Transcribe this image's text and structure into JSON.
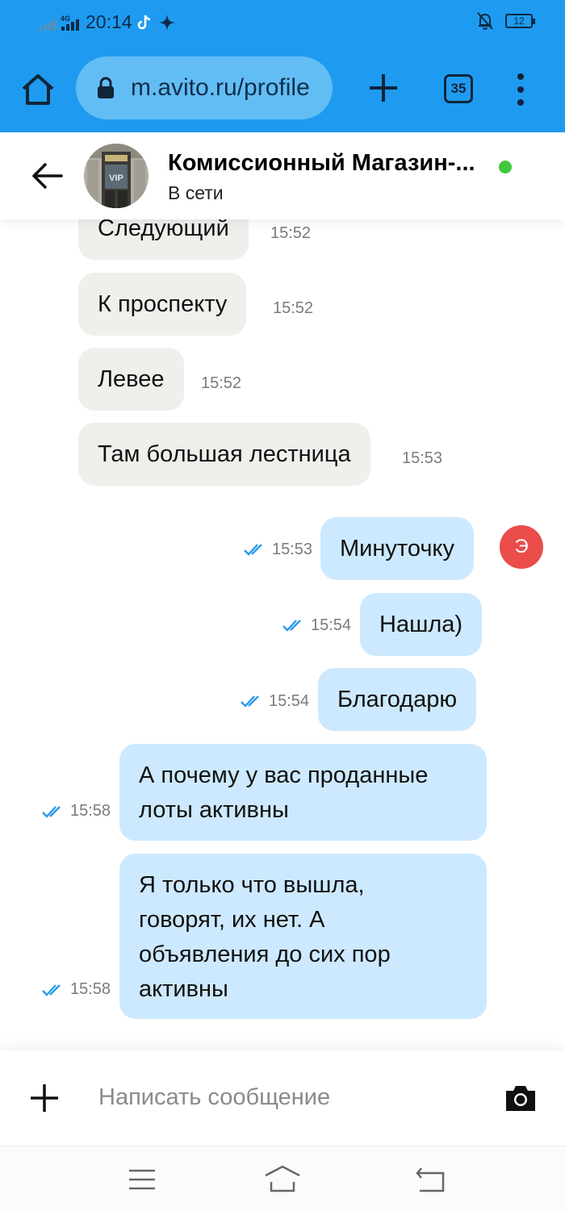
{
  "status_bar": {
    "network": "4G",
    "time": "20:14",
    "battery": "12"
  },
  "browser": {
    "url": "m.avito.ru/profile",
    "tab_count": "35"
  },
  "chat_header": {
    "name": "Комиссионный Магазин-...",
    "status": "В сети",
    "online_color": "#41c83a"
  },
  "messages": [
    {
      "direction": "in",
      "text": "Следующий",
      "time": "15:52"
    },
    {
      "direction": "in",
      "text": "К проспекту",
      "time": "15:52"
    },
    {
      "direction": "in",
      "text": "Левее",
      "time": "15:52"
    },
    {
      "direction": "in",
      "text": "Там большая лестница",
      "time": "15:53"
    },
    {
      "direction": "out",
      "text": "Минуточку",
      "time": "15:53",
      "read": true
    },
    {
      "direction": "out",
      "text": "Нашла)",
      "time": "15:54",
      "read": true
    },
    {
      "direction": "out",
      "text": "Благодарю",
      "time": "15:54",
      "read": true
    },
    {
      "direction": "out",
      "lines": [
        "А почему у вас проданные",
        "лоты активны"
      ],
      "time": "15:58",
      "read": true
    },
    {
      "direction": "out",
      "lines": [
        "Я только что вышла,",
        "говорят, их нет. А",
        "объявления до сих пор",
        "активны"
      ],
      "time": "15:58",
      "read": true
    }
  ],
  "user_avatar_letter": "Э",
  "composer": {
    "placeholder": "Написать сообщение"
  },
  "colors": {
    "browser_bar": "#1e9bf0",
    "incoming_bubble": "#f1efec",
    "outgoing_bubble": "#cde9ff",
    "read_ticks": "#2b9be8",
    "user_avatar": "#ea4d4a"
  }
}
